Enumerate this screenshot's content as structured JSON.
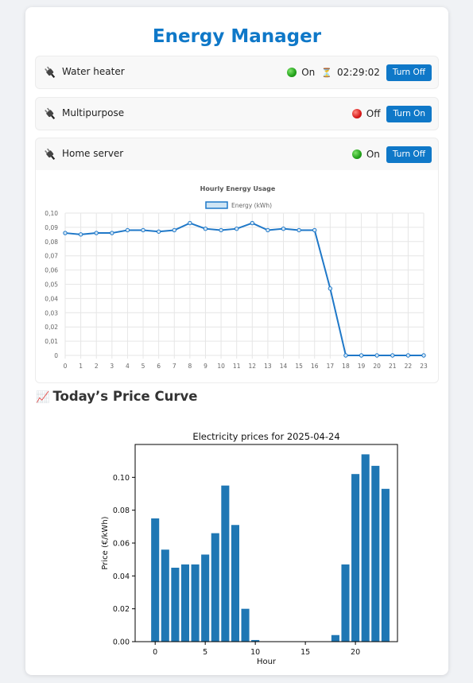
{
  "app": {
    "title": "Energy Manager"
  },
  "colors": {
    "accent": "#0f78c8",
    "on": "#22a11a",
    "off": "#d81b1b"
  },
  "devices": [
    {
      "name": "Water heater",
      "state": "On",
      "status": "on",
      "timer": "02:29:02",
      "button": "Turn Off",
      "icon": "plug-icon"
    },
    {
      "name": "Multipurpose",
      "state": "Off",
      "status": "off",
      "timer": "",
      "button": "Turn On",
      "icon": "plug-icon"
    },
    {
      "name": "Home server",
      "state": "On",
      "status": "on",
      "timer": "",
      "button": "Turn Off",
      "icon": "plug-icon"
    }
  ],
  "price_section": {
    "title": "Today’s Price Curve",
    "icon": "chart-increasing-icon"
  },
  "chart_data": [
    {
      "type": "line",
      "title": "Hourly Energy Usage",
      "legend": [
        "Energy (kWh)"
      ],
      "legend_position": "top-center",
      "grid": true,
      "x": [
        "0",
        "1",
        "2",
        "3",
        "4",
        "5",
        "6",
        "7",
        "8",
        "9",
        "10",
        "11",
        "12",
        "13",
        "14",
        "15",
        "16",
        "17",
        "18",
        "19",
        "20",
        "21",
        "22",
        "23"
      ],
      "series": [
        {
          "name": "Energy (kWh)",
          "values": [
            0.086,
            0.085,
            0.086,
            0.086,
            0.088,
            0.088,
            0.087,
            0.088,
            0.093,
            0.089,
            0.088,
            0.089,
            0.093,
            0.088,
            0.089,
            0.088,
            0.088,
            0.047,
            0,
            0,
            0,
            0,
            0,
            0
          ]
        }
      ],
      "ylim": [
        0,
        0.1
      ],
      "yticks": [
        "0",
        "0,01",
        "0,02",
        "0,03",
        "0,04",
        "0,05",
        "0,06",
        "0,07",
        "0,08",
        "0,09",
        "0,10"
      ],
      "color": "#1f78c8"
    },
    {
      "type": "bar",
      "title": "Electricity prices for 2025-04-24",
      "xlabel": "Hour",
      "ylabel": "Price (€/kWh)",
      "grid": false,
      "categories": [
        0,
        1,
        2,
        3,
        4,
        5,
        6,
        7,
        8,
        9,
        10,
        11,
        12,
        13,
        14,
        15,
        16,
        17,
        18,
        19,
        20,
        21,
        22,
        23
      ],
      "values": [
        0.075,
        0.056,
        0.045,
        0.047,
        0.047,
        0.053,
        0.066,
        0.095,
        0.071,
        0.02,
        0.001,
        0,
        0,
        0,
        0,
        0,
        0,
        0,
        0.004,
        0.047,
        0.102,
        0.114,
        0.107,
        0.093
      ],
      "xlim": [
        -2,
        24.2
      ],
      "ylim": [
        0,
        0.12
      ],
      "xticks": [
        "0",
        "5",
        "10",
        "15",
        "20"
      ],
      "yticks": [
        "0.00",
        "0.02",
        "0.04",
        "0.06",
        "0.08",
        "0.10"
      ],
      "color": "#1f77b4"
    }
  ]
}
